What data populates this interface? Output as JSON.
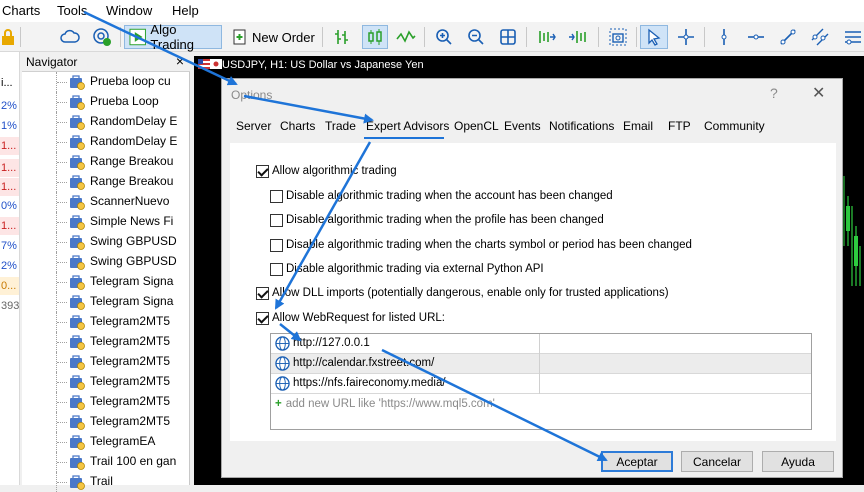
{
  "menu": {
    "items": [
      "Charts",
      "Tools",
      "Window",
      "Help"
    ]
  },
  "toolbar": {
    "algo_trading": "Algo Trading",
    "new_order": "New Order"
  },
  "market_values": [
    {
      "text": "i...",
      "color": "#000000",
      "bg": "#ffffff"
    },
    {
      "text": "2%",
      "color": "#1f4fc8",
      "bg": "#ffffff"
    },
    {
      "text": "1%",
      "color": "#1f4fc8",
      "bg": "#ffffff"
    },
    {
      "text": "1...",
      "color": "#c81e1e",
      "bg": "#fde5e5"
    },
    {
      "text": "1...",
      "color": "#c81e1e",
      "bg": "#fde5e5"
    },
    {
      "text": "1...",
      "color": "#c81e1e",
      "bg": "#fde5e5"
    },
    {
      "text": "0%",
      "color": "#1f4fc8",
      "bg": "#ffffff"
    },
    {
      "text": "1...",
      "color": "#c81e1e",
      "bg": "#fde5e5"
    },
    {
      "text": "7%",
      "color": "#1f4fc8",
      "bg": "#ffffff"
    },
    {
      "text": "2%",
      "color": "#1f4fc8",
      "bg": "#ffffff"
    },
    {
      "text": "0...",
      "color": "#c87a00",
      "bg": "#fff1d6"
    },
    {
      "text": "393",
      "color": "#666666",
      "bg": "#ffffff"
    }
  ],
  "navigator": {
    "title": "Navigator",
    "items": [
      "Prueba loop cu",
      "Prueba Loop",
      "RandomDelay E",
      "RandomDelay E",
      "Range Breakou",
      "Range Breakou",
      "ScannerNuevo",
      "Simple News Fi",
      "Swing GBPUSD",
      "Swing GBPUSD",
      "Telegram Signa",
      "Telegram Signa",
      "Telegram2MT5",
      "Telegram2MT5",
      "Telegram2MT5",
      "Telegram2MT5",
      "Telegram2MT5",
      "Telegram2MT5",
      "TelegramEA",
      "Trail 100 en gan",
      "Trail"
    ]
  },
  "chart": {
    "title": "USDJPY, H1:  US Dollar vs Japanese Yen"
  },
  "dialog": {
    "title": "Options",
    "help": "?",
    "tabs": [
      "Server",
      "Charts",
      "Trade",
      "Expert Advisors",
      "OpenCL",
      "Events",
      "Notifications",
      "Email",
      "FTP",
      "Community"
    ],
    "active_tab": "Expert Advisors",
    "options": [
      {
        "label": "Allow algorithmic trading",
        "checked": true
      },
      {
        "label": "Disable algorithmic trading when the account has been changed",
        "checked": false
      },
      {
        "label": "Disable algorithmic trading when the profile has been changed",
        "checked": false
      },
      {
        "label": "Disable algorithmic trading when the charts symbol or period has been changed",
        "checked": false
      },
      {
        "label": "Disable algorithmic trading via external Python API",
        "checked": false
      },
      {
        "label": "Allow DLL imports (potentially dangerous, enable only for trusted applications)",
        "checked": true
      },
      {
        "label": "Allow WebRequest for listed URL:",
        "checked": true
      }
    ],
    "urls": [
      "http://127.0.0.1",
      "http://calendar.fxstreet.com/",
      "https://nfs.faireconomy.media/"
    ],
    "add_url_placeholder": "add new URL like 'https://www.mql5.com'",
    "buttons": {
      "accept": "Aceptar",
      "cancel": "Cancelar",
      "help": "Ayuda"
    }
  },
  "colors": {
    "accent": "#1e74d8",
    "arrow": "#1e74d8",
    "chart_bg": "#000000"
  }
}
